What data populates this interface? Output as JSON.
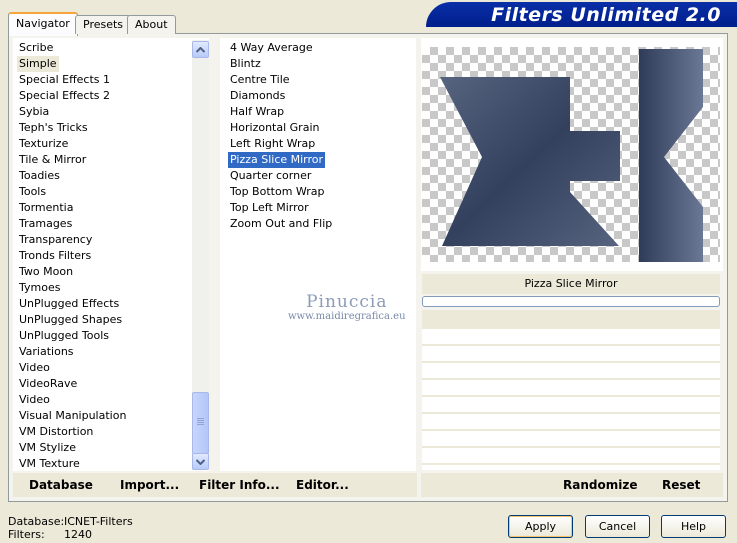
{
  "tabs": [
    {
      "label": "Navigator"
    },
    {
      "label": "Presets"
    },
    {
      "label": "About"
    }
  ],
  "banner": {
    "title": "Filters Unlimited 2.0"
  },
  "categories": {
    "items": [
      {
        "label": "Scribe"
      },
      {
        "label": "Simple",
        "selected": true
      },
      {
        "label": "Special Effects 1"
      },
      {
        "label": "Special Effects 2"
      },
      {
        "label": "Sybia"
      },
      {
        "label": "Teph's Tricks"
      },
      {
        "label": "Texturize"
      },
      {
        "label": "Tile & Mirror"
      },
      {
        "label": "Toadies"
      },
      {
        "label": "Tools"
      },
      {
        "label": "Tormentia"
      },
      {
        "label": "Tramages"
      },
      {
        "label": "Transparency"
      },
      {
        "label": "Tronds Filters"
      },
      {
        "label": "Two Moon"
      },
      {
        "label": "Tymoes"
      },
      {
        "label": "UnPlugged Effects"
      },
      {
        "label": "UnPlugged Shapes"
      },
      {
        "label": "UnPlugged Tools"
      },
      {
        "label": "Variations"
      },
      {
        "label": "Video"
      },
      {
        "label": "VideoRave"
      },
      {
        "label": "Video"
      },
      {
        "label": "Visual Manipulation"
      },
      {
        "label": "VM Distortion"
      },
      {
        "label": "VM Stylize"
      },
      {
        "label": "VM Texture"
      }
    ]
  },
  "filters": {
    "items": [
      {
        "label": "4 Way Average"
      },
      {
        "label": "Blintz"
      },
      {
        "label": "Centre Tile"
      },
      {
        "label": "Diamonds"
      },
      {
        "label": "Half Wrap"
      },
      {
        "label": "Horizontal Grain"
      },
      {
        "label": "Left Right Wrap"
      },
      {
        "label": "Pizza Slice Mirror",
        "selected": true
      },
      {
        "label": "Quarter corner"
      },
      {
        "label": "Top Bottom Wrap"
      },
      {
        "label": "Top Left Mirror"
      },
      {
        "label": "Zoom Out and Flip"
      }
    ]
  },
  "preview": {
    "filter_name": "Pizza Slice Mirror",
    "shape_color": "#3b4a6b"
  },
  "watermark": {
    "name": "Pinuccia",
    "url": "www.maidiregrafica.eu"
  },
  "left_bar": {
    "database": "Database",
    "import": "Import...",
    "filter_info": "Filter Info...",
    "editor": "Editor..."
  },
  "right_bar": {
    "randomize": "Randomize",
    "reset": "Reset"
  },
  "status": {
    "database_label": "Database:",
    "database_value": "ICNET-Filters",
    "filters_label": "Filters:",
    "filters_value": "1240"
  },
  "buttons": {
    "apply": "Apply",
    "cancel": "Cancel",
    "help": "Help"
  }
}
